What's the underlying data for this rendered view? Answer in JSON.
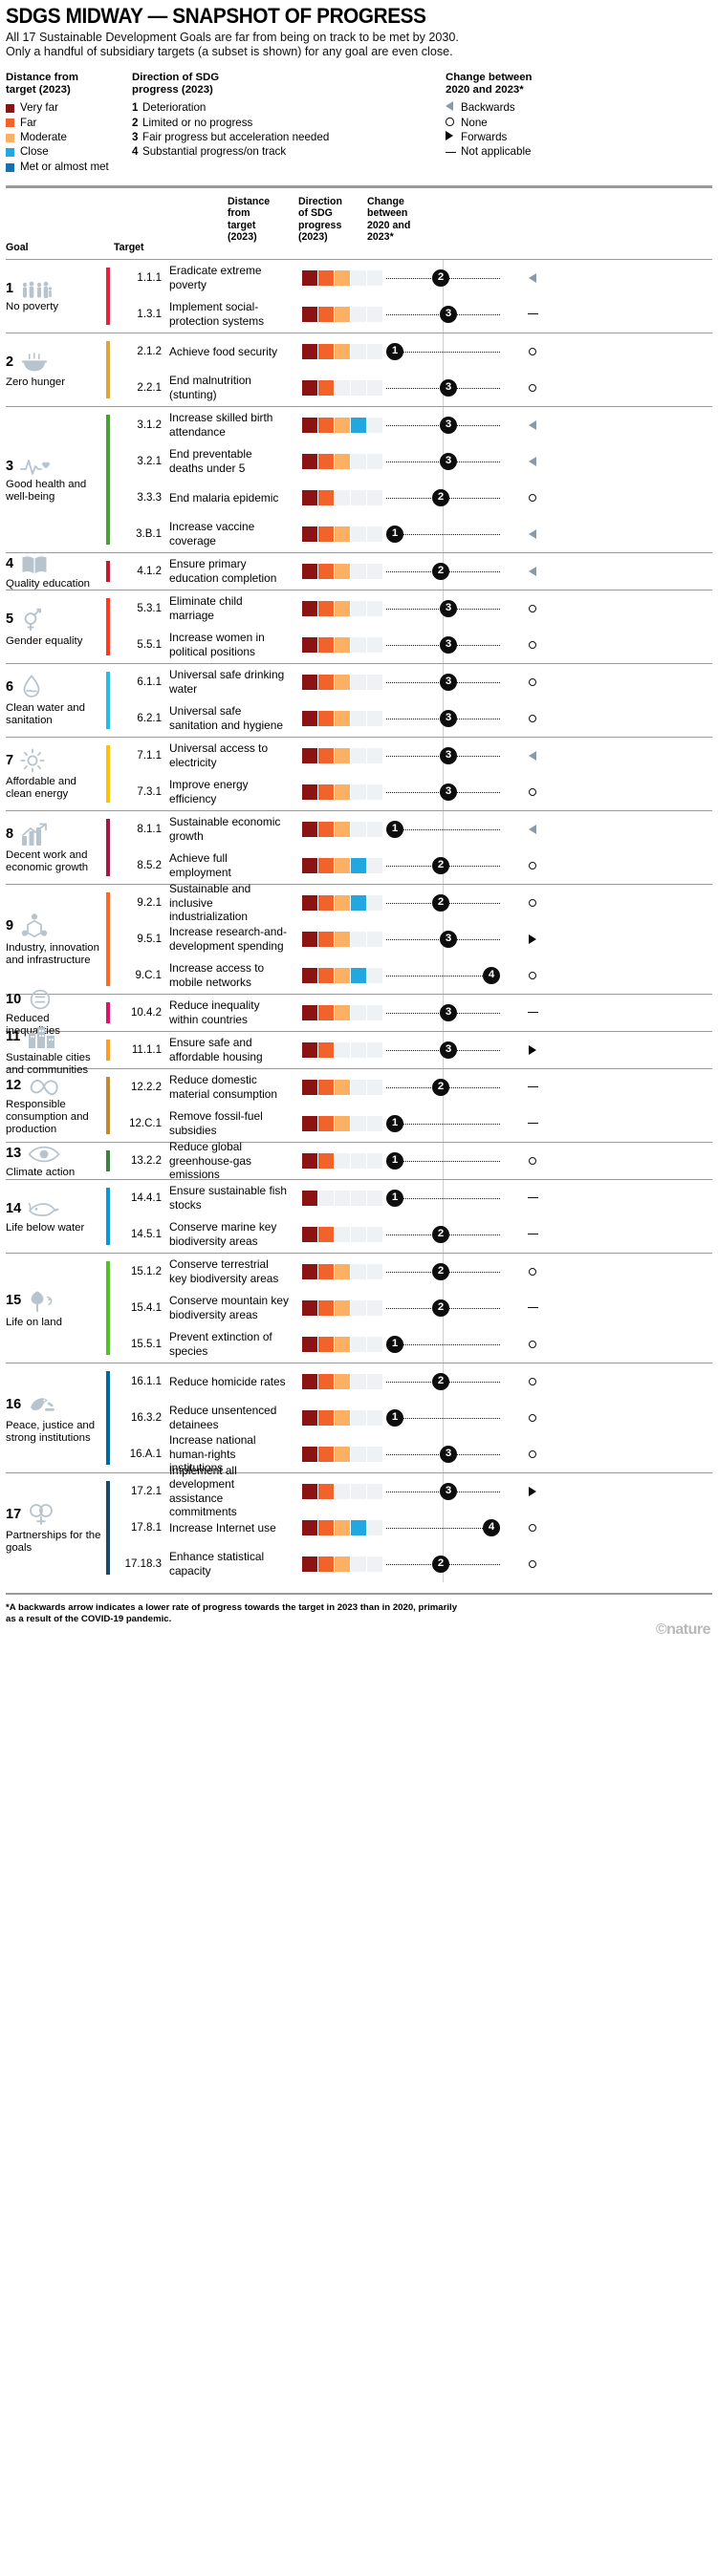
{
  "header": {
    "title": "SDGS MIDWAY — SNAPSHOT OF PROGRESS",
    "standfirst_line1": "All 17 Sustainable Development Goals are far from being on track to be met by 2030.",
    "standfirst_line2": "Only a handful of subsidiary targets (a subset is shown) for any goal are even close."
  },
  "legend": {
    "distance": {
      "heading_line1": "Distance from",
      "heading_line2": "target (2023)",
      "items": [
        {
          "label": "Very far",
          "color": "#8c1313"
        },
        {
          "label": "Far",
          "color": "#f2622b"
        },
        {
          "label": "Moderate",
          "color": "#fbb064"
        },
        {
          "label": "Close",
          "color": "#22a8e0"
        },
        {
          "label": "Met or almost met",
          "color": "#1272b5"
        }
      ]
    },
    "direction": {
      "heading_line1": "Direction of SDG",
      "heading_line2": "progress (2023)",
      "items": [
        {
          "num": "1",
          "label": "Deterioration"
        },
        {
          "num": "2",
          "label": "Limited or no progress"
        },
        {
          "num": "3",
          "label": "Fair progress but acceleration needed"
        },
        {
          "num": "4",
          "label": "Substantial progress/on track"
        }
      ]
    },
    "change": {
      "heading_line1": "Change between",
      "heading_line2": "2020 and 2023*",
      "items": [
        {
          "symbol": "backwards-arrow-icon",
          "label": "Backwards"
        },
        {
          "symbol": "open-circle-icon",
          "label": "None"
        },
        {
          "symbol": "forwards-arrow-icon",
          "label": "Forwards"
        },
        {
          "symbol": "dash-icon",
          "label": "Not applicable"
        }
      ]
    }
  },
  "columns": {
    "goal": "Goal",
    "target": "Target",
    "distance": "Distance from target (2023)",
    "direction": "Direction of SDG progress (2023)",
    "change": "Change between 2020 and 2023*"
  },
  "footnote": "*A backwards arrow indicates a lower rate of progress towards the target in 2023 than in 2020, primarily as a result of the COVID-19 pandemic.",
  "brand": "©nature",
  "palette": {
    "very_far": "#8c1313",
    "far": "#f2622b",
    "moderate": "#fbb064",
    "close": "#22a8e0",
    "met": "#1272b5",
    "empty": "#eef2f5",
    "badge": "#0d0d0d",
    "backwards": "#8c9aa6",
    "forwards": "#000000"
  },
  "chart_data": {
    "type": "table",
    "title": "SDGS MIDWAY — SNAPSHOT OF PROGRESS",
    "columns": [
      "Goal",
      "Target",
      "Distance from target (2023)",
      "Direction of SDG progress (2023)",
      "Change between 2020 and 2023*"
    ],
    "distance_scale": [
      "Very far",
      "Far",
      "Moderate",
      "Close",
      "Met or almost met"
    ],
    "direction_scale": {
      "1": "Deterioration",
      "2": "Limited or no progress",
      "3": "Fair progress but acceleration needed",
      "4": "Substantial progress/on track"
    },
    "change_scale": [
      "Backwards",
      "None",
      "Forwards",
      "Not applicable"
    ],
    "goals": [
      {
        "num": "1",
        "label": "No poverty",
        "color": "#e5243b",
        "icon": "people-icon",
        "targets": [
          {
            "code": "1.1.1",
            "name": "Eradicate extreme poverty",
            "distance": 3,
            "direction": 2,
            "change": "backwards"
          },
          {
            "code": "1.3.1",
            "name": "Implement social-protection systems",
            "distance": 3,
            "direction": 3,
            "change": "na"
          }
        ]
      },
      {
        "num": "2",
        "label": "Zero hunger",
        "color": "#dda63a",
        "icon": "bowl-icon",
        "targets": [
          {
            "code": "2.1.2",
            "name": "Achieve food security",
            "distance": 3,
            "direction": 1,
            "change": "none"
          },
          {
            "code": "2.2.1",
            "name": "End malnutrition (stunting)",
            "distance": 2,
            "direction": 3,
            "change": "none"
          }
        ]
      },
      {
        "num": "3",
        "label": "Good health and well-being",
        "color": "#4c9f38",
        "icon": "heartbeat-icon",
        "targets": [
          {
            "code": "3.1.2",
            "name": "Increase skilled birth attendance",
            "distance": 4,
            "direction": 3,
            "change": "backwards"
          },
          {
            "code": "3.2.1",
            "name": "End preventable deaths under 5",
            "distance": 3,
            "direction": 3,
            "change": "backwards"
          },
          {
            "code": "3.3.3",
            "name": "End malaria epidemic",
            "distance": 2,
            "direction": 2,
            "change": "none"
          },
          {
            "code": "3.B.1",
            "name": "Increase vaccine coverage",
            "distance": 3,
            "direction": 1,
            "change": "backwards"
          }
        ]
      },
      {
        "num": "4",
        "label": "Quality education",
        "color": "#c5192d",
        "icon": "book-icon",
        "targets": [
          {
            "code": "4.1.2",
            "name": "Ensure primary education completion",
            "distance": 3,
            "direction": 2,
            "change": "backwards"
          }
        ]
      },
      {
        "num": "5",
        "label": "Gender equality",
        "color": "#ff3a21",
        "icon": "gender-icon",
        "targets": [
          {
            "code": "5.3.1",
            "name": "Eliminate child marriage",
            "distance": 3,
            "direction": 3,
            "change": "none"
          },
          {
            "code": "5.5.1",
            "name": "Increase women in political positions",
            "distance": 3,
            "direction": 3,
            "change": "none"
          }
        ]
      },
      {
        "num": "6",
        "label": "Clean water and sanitation",
        "color": "#26bde2",
        "icon": "water-drop-icon",
        "targets": [
          {
            "code": "6.1.1",
            "name": "Universal safe drinking water",
            "distance": 3,
            "direction": 3,
            "change": "none"
          },
          {
            "code": "6.2.1",
            "name": "Universal safe sanitation and hygiene",
            "distance": 3,
            "direction": 3,
            "change": "none"
          }
        ]
      },
      {
        "num": "7",
        "label": "Affordable and clean energy",
        "color": "#fcc30b",
        "icon": "sun-icon",
        "targets": [
          {
            "code": "7.1.1",
            "name": "Universal access to electricity",
            "distance": 3,
            "direction": 3,
            "change": "backwards"
          },
          {
            "code": "7.3.1",
            "name": "Improve energy efficiency",
            "distance": 3,
            "direction": 3,
            "change": "none"
          }
        ]
      },
      {
        "num": "8",
        "label": "Decent work and economic growth",
        "color": "#a21942",
        "icon": "growth-chart-icon",
        "targets": [
          {
            "code": "8.1.1",
            "name": "Sustainable economic growth",
            "distance": 3,
            "direction": 1,
            "change": "backwards"
          },
          {
            "code": "8.5.2",
            "name": "Achieve full employment",
            "distance": 4,
            "direction": 2,
            "change": "none"
          }
        ]
      },
      {
        "num": "9",
        "label": "Industry, innovation and infrastructure",
        "color": "#fd6925",
        "icon": "industry-icon",
        "targets": [
          {
            "code": "9.2.1",
            "name": "Sustainable and inclusive industrialization",
            "distance": 4,
            "direction": 2,
            "change": "none"
          },
          {
            "code": "9.5.1",
            "name": "Increase research-and-development spending",
            "distance": 3,
            "direction": 3,
            "change": "forwards"
          },
          {
            "code": "9.C.1",
            "name": "Increase access to mobile networks",
            "distance": 4,
            "direction": 4,
            "change": "none"
          }
        ]
      },
      {
        "num": "10",
        "label": "Reduced inequalities",
        "color": "#dd1367",
        "icon": "equals-icon",
        "targets": [
          {
            "code": "10.4.2",
            "name": "Reduce inequality within countries",
            "distance": 3,
            "direction": 3,
            "change": "na"
          }
        ]
      },
      {
        "num": "11",
        "label": "Sustainable cities and communities",
        "color": "#fd9d24",
        "icon": "city-icon",
        "targets": [
          {
            "code": "11.1.1",
            "name": "Ensure safe and affordable housing",
            "distance": 2,
            "direction": 3,
            "change": "forwards"
          }
        ]
      },
      {
        "num": "12",
        "label": "Responsible consumption and production",
        "color": "#bf8b2e",
        "icon": "infinity-icon",
        "targets": [
          {
            "code": "12.2.2",
            "name": "Reduce domestic material consumption",
            "distance": 3,
            "direction": 2,
            "change": "na"
          },
          {
            "code": "12.C.1",
            "name": "Remove fossil-fuel subsidies",
            "distance": 3,
            "direction": 1,
            "change": "na"
          }
        ]
      },
      {
        "num": "13",
        "label": "Climate action",
        "color": "#3f7e44",
        "icon": "eye-earth-icon",
        "targets": [
          {
            "code": "13.2.2",
            "name": "Reduce global greenhouse-gas emissions",
            "distance": 2,
            "direction": 1,
            "change": "none"
          }
        ]
      },
      {
        "num": "14",
        "label": "Life below water",
        "color": "#0a97d9",
        "icon": "fish-icon",
        "targets": [
          {
            "code": "14.4.1",
            "name": "Ensure sustainable fish stocks",
            "distance": 1,
            "direction": 1,
            "change": "na"
          },
          {
            "code": "14.5.1",
            "name": "Conserve marine key biodiversity areas",
            "distance": 2,
            "direction": 2,
            "change": "na"
          }
        ]
      },
      {
        "num": "15",
        "label": "Life on land",
        "color": "#56c02b",
        "icon": "tree-bird-icon",
        "targets": [
          {
            "code": "15.1.2",
            "name": "Conserve terrestrial key biodiversity areas",
            "distance": 3,
            "direction": 2,
            "change": "none"
          },
          {
            "code": "15.4.1",
            "name": "Conserve mountain key biodiversity areas",
            "distance": 3,
            "direction": 2,
            "change": "na"
          },
          {
            "code": "15.5.1",
            "name": "Prevent extinction of species",
            "distance": 3,
            "direction": 1,
            "change": "none"
          }
        ]
      },
      {
        "num": "16",
        "label": "Peace, justice and strong institutions",
        "color": "#00689d",
        "icon": "dove-gavel-icon",
        "targets": [
          {
            "code": "16.1.1",
            "name": "Reduce homicide rates",
            "distance": 3,
            "direction": 2,
            "change": "none"
          },
          {
            "code": "16.3.2",
            "name": "Reduce unsentenced detainees",
            "distance": 3,
            "direction": 1,
            "change": "none"
          },
          {
            "code": "16.A.1",
            "name": "Increase national human-rights institutions",
            "distance": 3,
            "direction": 3,
            "change": "none"
          }
        ]
      },
      {
        "num": "17",
        "label": "Partnerships for the goals",
        "color": "#19486a",
        "icon": "circles-icon",
        "targets": [
          {
            "code": "17.2.1",
            "name": "Implement all development assistance commitments",
            "distance": 2,
            "direction": 3,
            "change": "forwards"
          },
          {
            "code": "17.8.1",
            "name": "Increase Internet use",
            "distance": 4,
            "direction": 4,
            "change": "none"
          },
          {
            "code": "17.18.3",
            "name": "Enhance statistical capacity",
            "distance": 3,
            "direction": 2,
            "change": "none"
          }
        ]
      }
    ]
  }
}
